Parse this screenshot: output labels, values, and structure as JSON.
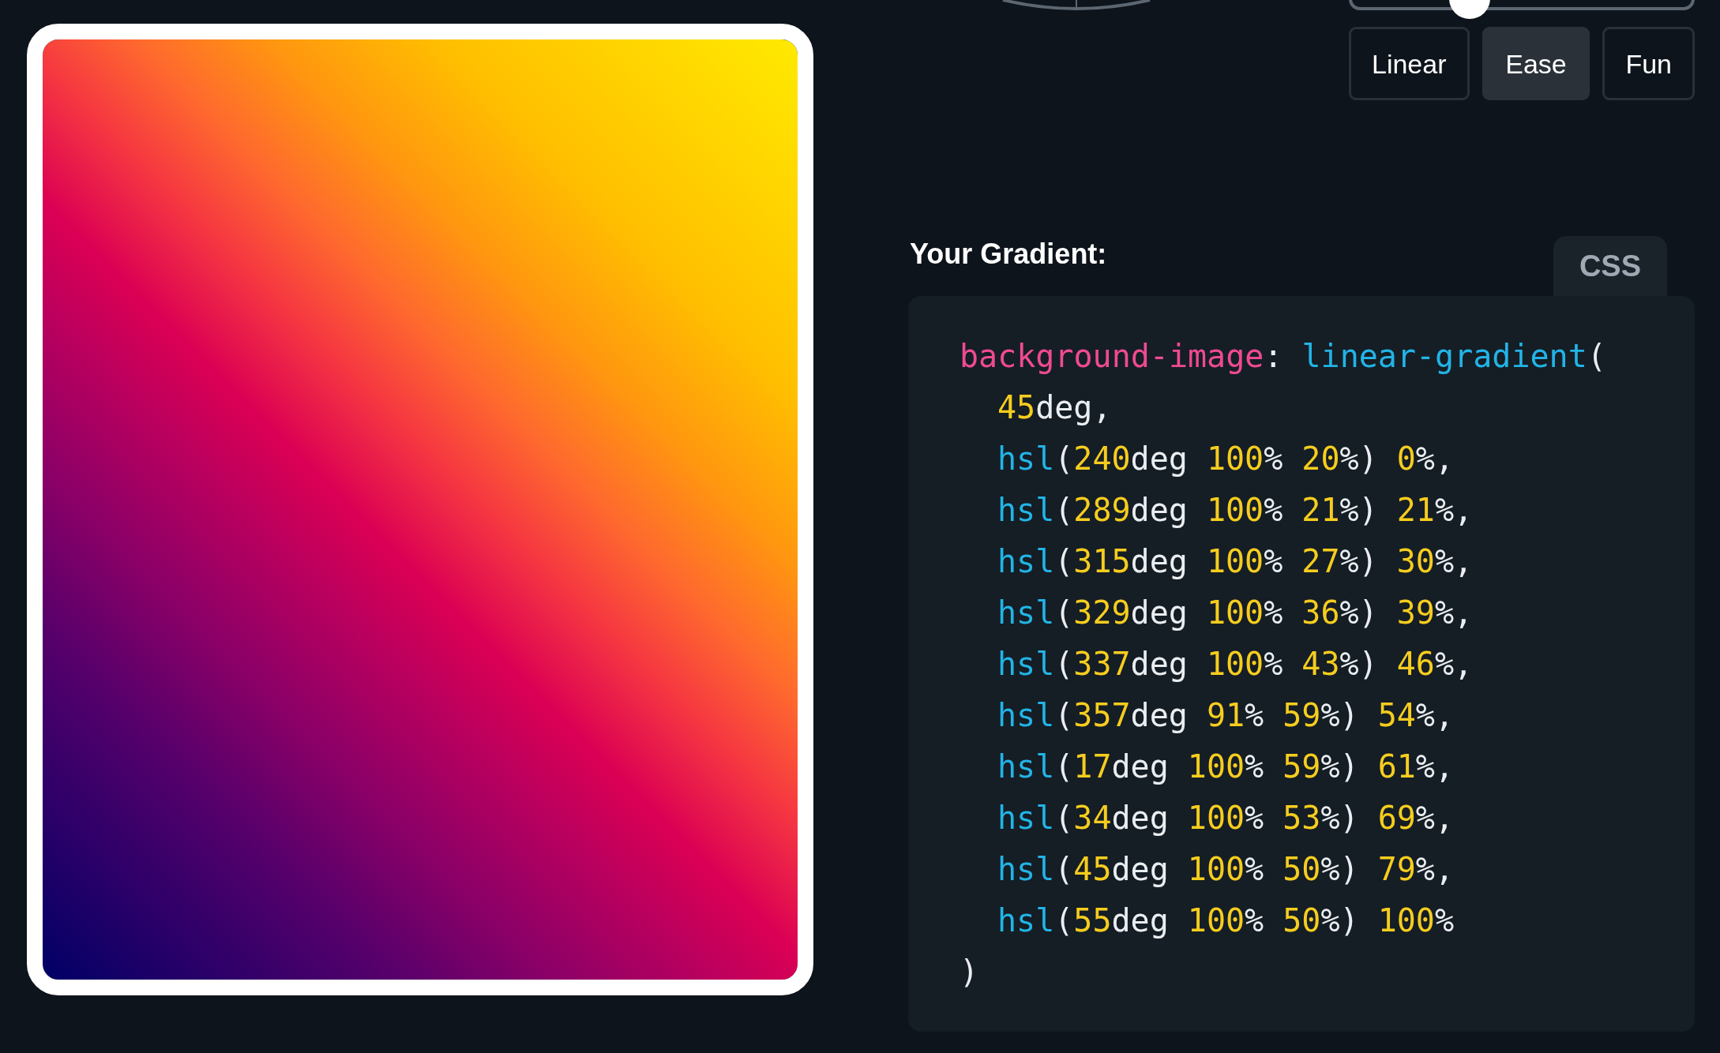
{
  "slider": {
    "level": 0.35
  },
  "easing_buttons": [
    {
      "label": "Linear",
      "selected": false
    },
    {
      "label": "Ease",
      "selected": true
    },
    {
      "label": "Fun",
      "selected": false
    }
  ],
  "output": {
    "title": "Your Gradient:",
    "tab": "CSS",
    "code": {
      "lines": [
        {
          "tokens": [
            {
              "kind": "property",
              "text": "background-image"
            },
            {
              "kind": "plain",
              "text": ": "
            },
            {
              "kind": "function",
              "text": "linear-gradient"
            },
            {
              "kind": "plain",
              "text": "("
            }
          ],
          "children": [
            {
              "tokens": [
                {
                  "kind": "number",
                  "text": "45"
                },
                {
                  "kind": "plain",
                  "text": "deg,"
                }
              ]
            },
            {
              "tokens": [
                {
                  "kind": "function",
                  "text": "hsl"
                },
                {
                  "kind": "plain",
                  "text": "("
                },
                {
                  "kind": "number",
                  "text": "240"
                },
                {
                  "kind": "plain",
                  "text": "deg "
                },
                {
                  "kind": "number",
                  "text": "100"
                },
                {
                  "kind": "plain",
                  "text": "% "
                },
                {
                  "kind": "number",
                  "text": "20"
                },
                {
                  "kind": "plain",
                  "text": "%) "
                },
                {
                  "kind": "number",
                  "text": "0"
                },
                {
                  "kind": "plain",
                  "text": "%,"
                }
              ]
            },
            {
              "tokens": [
                {
                  "kind": "function",
                  "text": "hsl"
                },
                {
                  "kind": "plain",
                  "text": "("
                },
                {
                  "kind": "number",
                  "text": "289"
                },
                {
                  "kind": "plain",
                  "text": "deg "
                },
                {
                  "kind": "number",
                  "text": "100"
                },
                {
                  "kind": "plain",
                  "text": "% "
                },
                {
                  "kind": "number",
                  "text": "21"
                },
                {
                  "kind": "plain",
                  "text": "%) "
                },
                {
                  "kind": "number",
                  "text": "21"
                },
                {
                  "kind": "plain",
                  "text": "%,"
                }
              ]
            },
            {
              "tokens": [
                {
                  "kind": "function",
                  "text": "hsl"
                },
                {
                  "kind": "plain",
                  "text": "("
                },
                {
                  "kind": "number",
                  "text": "315"
                },
                {
                  "kind": "plain",
                  "text": "deg "
                },
                {
                  "kind": "number",
                  "text": "100"
                },
                {
                  "kind": "plain",
                  "text": "% "
                },
                {
                  "kind": "number",
                  "text": "27"
                },
                {
                  "kind": "plain",
                  "text": "%) "
                },
                {
                  "kind": "number",
                  "text": "30"
                },
                {
                  "kind": "plain",
                  "text": "%,"
                }
              ]
            },
            {
              "tokens": [
                {
                  "kind": "function",
                  "text": "hsl"
                },
                {
                  "kind": "plain",
                  "text": "("
                },
                {
                  "kind": "number",
                  "text": "329"
                },
                {
                  "kind": "plain",
                  "text": "deg "
                },
                {
                  "kind": "number",
                  "text": "100"
                },
                {
                  "kind": "plain",
                  "text": "% "
                },
                {
                  "kind": "number",
                  "text": "36"
                },
                {
                  "kind": "plain",
                  "text": "%) "
                },
                {
                  "kind": "number",
                  "text": "39"
                },
                {
                  "kind": "plain",
                  "text": "%,"
                }
              ]
            },
            {
              "tokens": [
                {
                  "kind": "function",
                  "text": "hsl"
                },
                {
                  "kind": "plain",
                  "text": "("
                },
                {
                  "kind": "number",
                  "text": "337"
                },
                {
                  "kind": "plain",
                  "text": "deg "
                },
                {
                  "kind": "number",
                  "text": "100"
                },
                {
                  "kind": "plain",
                  "text": "% "
                },
                {
                  "kind": "number",
                  "text": "43"
                },
                {
                  "kind": "plain",
                  "text": "%) "
                },
                {
                  "kind": "number",
                  "text": "46"
                },
                {
                  "kind": "plain",
                  "text": "%,"
                }
              ]
            },
            {
              "tokens": [
                {
                  "kind": "function",
                  "text": "hsl"
                },
                {
                  "kind": "plain",
                  "text": "("
                },
                {
                  "kind": "number",
                  "text": "357"
                },
                {
                  "kind": "plain",
                  "text": "deg "
                },
                {
                  "kind": "number",
                  "text": "91"
                },
                {
                  "kind": "plain",
                  "text": "% "
                },
                {
                  "kind": "number",
                  "text": "59"
                },
                {
                  "kind": "plain",
                  "text": "%) "
                },
                {
                  "kind": "number",
                  "text": "54"
                },
                {
                  "kind": "plain",
                  "text": "%,"
                }
              ]
            },
            {
              "tokens": [
                {
                  "kind": "function",
                  "text": "hsl"
                },
                {
                  "kind": "plain",
                  "text": "("
                },
                {
                  "kind": "number",
                  "text": "17"
                },
                {
                  "kind": "plain",
                  "text": "deg "
                },
                {
                  "kind": "number",
                  "text": "100"
                },
                {
                  "kind": "plain",
                  "text": "% "
                },
                {
                  "kind": "number",
                  "text": "59"
                },
                {
                  "kind": "plain",
                  "text": "%) "
                },
                {
                  "kind": "number",
                  "text": "61"
                },
                {
                  "kind": "plain",
                  "text": "%,"
                }
              ]
            },
            {
              "tokens": [
                {
                  "kind": "function",
                  "text": "hsl"
                },
                {
                  "kind": "plain",
                  "text": "("
                },
                {
                  "kind": "number",
                  "text": "34"
                },
                {
                  "kind": "plain",
                  "text": "deg "
                },
                {
                  "kind": "number",
                  "text": "100"
                },
                {
                  "kind": "plain",
                  "text": "% "
                },
                {
                  "kind": "number",
                  "text": "53"
                },
                {
                  "kind": "plain",
                  "text": "%) "
                },
                {
                  "kind": "number",
                  "text": "69"
                },
                {
                  "kind": "plain",
                  "text": "%,"
                }
              ]
            },
            {
              "tokens": [
                {
                  "kind": "function",
                  "text": "hsl"
                },
                {
                  "kind": "plain",
                  "text": "("
                },
                {
                  "kind": "number",
                  "text": "45"
                },
                {
                  "kind": "plain",
                  "text": "deg "
                },
                {
                  "kind": "number",
                  "text": "100"
                },
                {
                  "kind": "plain",
                  "text": "% "
                },
                {
                  "kind": "number",
                  "text": "50"
                },
                {
                  "kind": "plain",
                  "text": "%) "
                },
                {
                  "kind": "number",
                  "text": "79"
                },
                {
                  "kind": "plain",
                  "text": "%,"
                }
              ]
            },
            {
              "tokens": [
                {
                  "kind": "function",
                  "text": "hsl"
                },
                {
                  "kind": "plain",
                  "text": "("
                },
                {
                  "kind": "number",
                  "text": "55"
                },
                {
                  "kind": "plain",
                  "text": "deg "
                },
                {
                  "kind": "number",
                  "text": "100"
                },
                {
                  "kind": "plain",
                  "text": "% "
                },
                {
                  "kind": "number",
                  "text": "50"
                },
                {
                  "kind": "plain",
                  "text": "%) "
                },
                {
                  "kind": "number",
                  "text": "100"
                },
                {
                  "kind": "plain",
                  "text": "%"
                }
              ]
            }
          ]
        },
        {
          "tokens": [
            {
              "kind": "plain",
              "text": ")"
            }
          ]
        }
      ]
    }
  }
}
